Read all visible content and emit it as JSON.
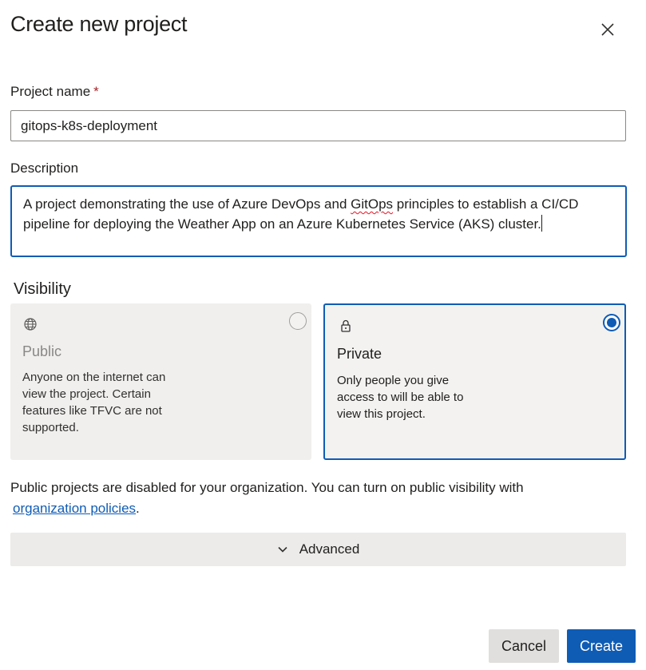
{
  "dialog": {
    "title": "Create new project",
    "close_icon": "close-icon"
  },
  "project_name": {
    "label": "Project name",
    "required_marker": "*",
    "value": "gitops-k8s-deployment"
  },
  "description": {
    "label": "Description",
    "value_before": "A project demonstrating the use of Azure DevOps and ",
    "value_misspelled": "GitOps",
    "value_after": " principles to establish a CI/CD pipeline for deploying the Weather App on an Azure Kubernetes Service (AKS) cluster."
  },
  "visibility": {
    "label": "Visibility",
    "options": [
      {
        "title": "Public",
        "icon": "globe-icon",
        "description": "Anyone on the internet can view the project. Certain features like TFVC are not supported.",
        "selected": false
      },
      {
        "title": "Private",
        "icon": "lock-icon",
        "description": "Only people you give access to will be able to view this project.",
        "selected": true
      }
    ]
  },
  "notice": {
    "text": "Public projects are disabled for your organization. You can turn on public visibility with ",
    "link": "organization policies",
    "suffix": "."
  },
  "advanced": {
    "label": "Advanced",
    "icon": "chevron-down-icon"
  },
  "buttons": {
    "cancel": "Cancel",
    "create": "Create"
  },
  "colors": {
    "accent": "#0f5cb5",
    "required": "#a4262c",
    "misspell": "#e81123"
  }
}
